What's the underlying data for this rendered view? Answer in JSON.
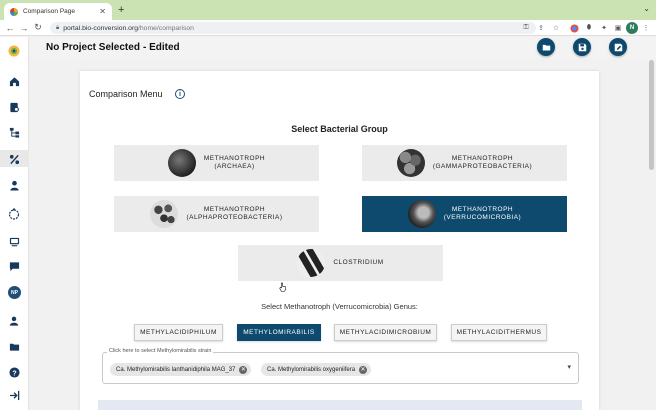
{
  "browser": {
    "tab_title": "Comparison Page",
    "tab_close": "✕",
    "new_tab": "+",
    "tab_controls": "⌄",
    "url_host": "portal.bio-conversion.org",
    "url_path": "/home/comparison",
    "profile_initial": "N"
  },
  "sidebar": {
    "avatar_initials": "NP"
  },
  "header": {
    "project": "No Project Selected",
    "status": "- Edited"
  },
  "card": {
    "title": "Comparison Menu",
    "info_icon": "i",
    "section_title": "Select Bacterial Group",
    "groups": [
      {
        "label": "METHANOTROPH\n(ARCHAEA)",
        "active": false
      },
      {
        "label": "METHANOTROPH\n(GAMMAPROTEOBACTERIA)",
        "active": false
      },
      {
        "label": "METHANOTROPH\n(ALPHAPROTEOBACTERIA)",
        "active": false
      },
      {
        "label": "METHANOTROPH\n(VERRUCOMICROBIA)",
        "active": true
      },
      {
        "label": "CLOSTRIDIUM",
        "active": false
      }
    ],
    "genus_title": "Select Methanotroph (Verrucomicrobia) Genus:",
    "genera": [
      {
        "label": "METHYLACIDIPHILUM",
        "active": false
      },
      {
        "label": "METHYLOMIRABILIS",
        "active": true
      },
      {
        "label": "METHYLACIDIMICROBIUM",
        "active": false
      },
      {
        "label": "METHYLACIDITHERMUS",
        "active": false
      }
    ],
    "strain_label": "Click here to select Methylomirabilis strain",
    "strains": [
      "Ca. Methylomirabilis lanthanidiphila MAG_37",
      "Ca. Methylomirabilis oxygeniifera"
    ],
    "chip_remove": "✕",
    "dropdown_icon": "▾"
  },
  "colors": {
    "accent": "#0d4a6e",
    "tabstrip": "#cbe3b3"
  }
}
